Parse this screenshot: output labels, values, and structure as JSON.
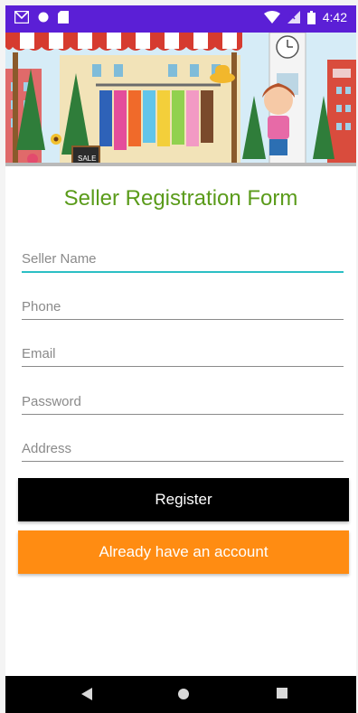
{
  "status_bar": {
    "time": "4:42",
    "icons": [
      "gmail-icon",
      "circle-icon",
      "sd-card-icon",
      "wifi-icon",
      "signal-icon",
      "battery-icon"
    ]
  },
  "banner": {
    "sign_text": "SALE"
  },
  "form": {
    "title": "Seller Registration Form",
    "fields": [
      {
        "placeholder": "Seller Name",
        "value": ""
      },
      {
        "placeholder": "Phone",
        "value": ""
      },
      {
        "placeholder": "Email",
        "value": ""
      },
      {
        "placeholder": "Password",
        "value": ""
      },
      {
        "placeholder": "Address",
        "value": ""
      }
    ],
    "register_label": "Register",
    "login_label": "Already have an account"
  },
  "colors": {
    "status_bar": "#5b1fd6",
    "title": "#5a9b1a",
    "focus_underline": "#2bbfc4",
    "register_button": "#000000",
    "login_button": "#ff8c12"
  },
  "nav_bar": {
    "icons": [
      "back-icon",
      "home-icon",
      "recents-icon"
    ]
  }
}
